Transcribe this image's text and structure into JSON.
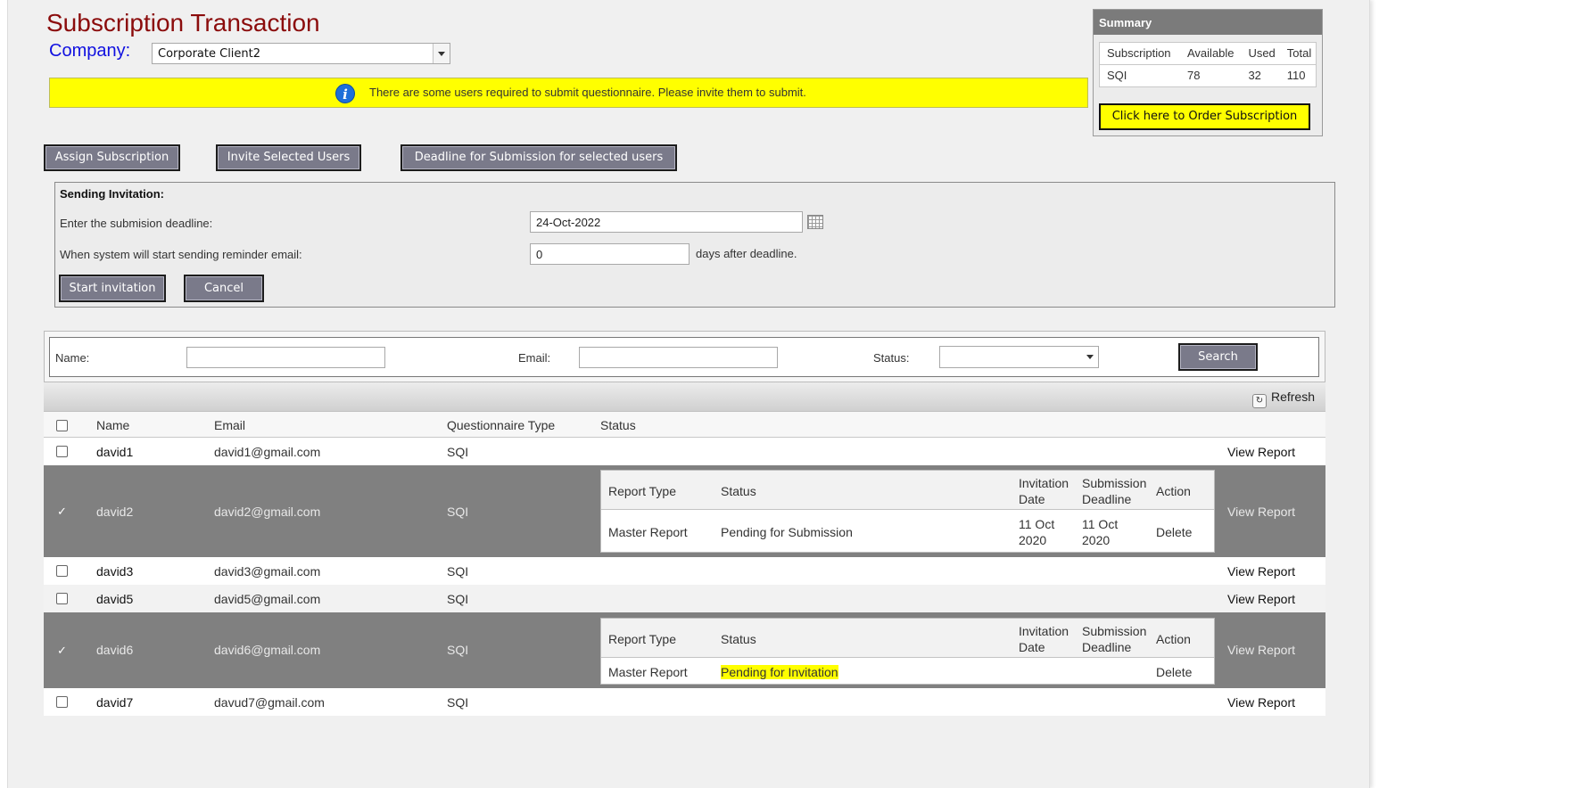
{
  "page": {
    "title": "Subscription Transaction"
  },
  "company": {
    "label": "Company:",
    "selected": "Corporate Client2"
  },
  "notice": {
    "icon": "info-icon",
    "text": "There are some users required to submit questionnaire. Please invite them to submit."
  },
  "summary": {
    "title": "Summary",
    "columns": [
      "Subscription",
      "Available",
      "Used",
      "Total"
    ],
    "row": [
      "SQI",
      "78",
      "32",
      "110"
    ],
    "order_label": "Click here to Order Subscription"
  },
  "actions": {
    "assign": "Assign Subscription",
    "invite": "Invite Selected Users",
    "deadline": "Deadline for Submission for selected users"
  },
  "invitation": {
    "heading": "Sending Invitation:",
    "deadline_label": "Enter the submision deadline:",
    "deadline_value": "24-Oct-2022",
    "reminder_label": "When system will start sending reminder email:",
    "reminder_value": "0",
    "reminder_suffix": "days after deadline.",
    "start_label": "Start invitation",
    "cancel_label": "Cancel"
  },
  "search": {
    "name_label": "Name:",
    "email_label": "Email:",
    "status_label": "Status:",
    "status_value": "",
    "button": "Search"
  },
  "toolbar": {
    "refresh": "Refresh"
  },
  "grid": {
    "columns": [
      "Name",
      "Email",
      "Questionnaire Type",
      "Status"
    ],
    "view_report": "View Report",
    "rows": [
      {
        "name": "david1",
        "email": "david1@gmail.com",
        "type": "SQI",
        "checked": false
      },
      {
        "name": "david2",
        "email": "david2@gmail.com",
        "type": "SQI",
        "checked": true
      },
      {
        "name": "david3",
        "email": "david3@gmail.com",
        "type": "SQI",
        "checked": false
      },
      {
        "name": "david5",
        "email": "david5@gmail.com",
        "type": "SQI",
        "checked": false
      },
      {
        "name": "david6",
        "email": "david6@gmail.com",
        "type": "SQI",
        "checked": true
      },
      {
        "name": "david7",
        "email": "davud7@gmail.com",
        "type": "SQI",
        "checked": false
      }
    ],
    "sub_columns": {
      "report_type": "Report Type",
      "status": "Status",
      "inv_date_1": "Invitation",
      "inv_date_2": "Date",
      "sub_dl_1": "Submission",
      "sub_dl_2": "Deadline",
      "action": "Action"
    },
    "sub_rows": [
      {
        "report_type": "Master Report",
        "status": "Pending for Submission",
        "inv_date_1": "11 Oct",
        "inv_date_2": "2020",
        "sub_dl_1": "11 Oct",
        "sub_dl_2": "2020",
        "action": "Delete"
      },
      {
        "report_type": "Master Report",
        "status": "Pending for Invitation",
        "action": "Delete"
      }
    ]
  },
  "colors": {
    "title": "#8b0c0c",
    "company_label": "#1010e0",
    "notice_bg": "#ffff00",
    "selected_row": "#808080",
    "button": "#7a7a8a",
    "link": "#1a1ae0"
  }
}
